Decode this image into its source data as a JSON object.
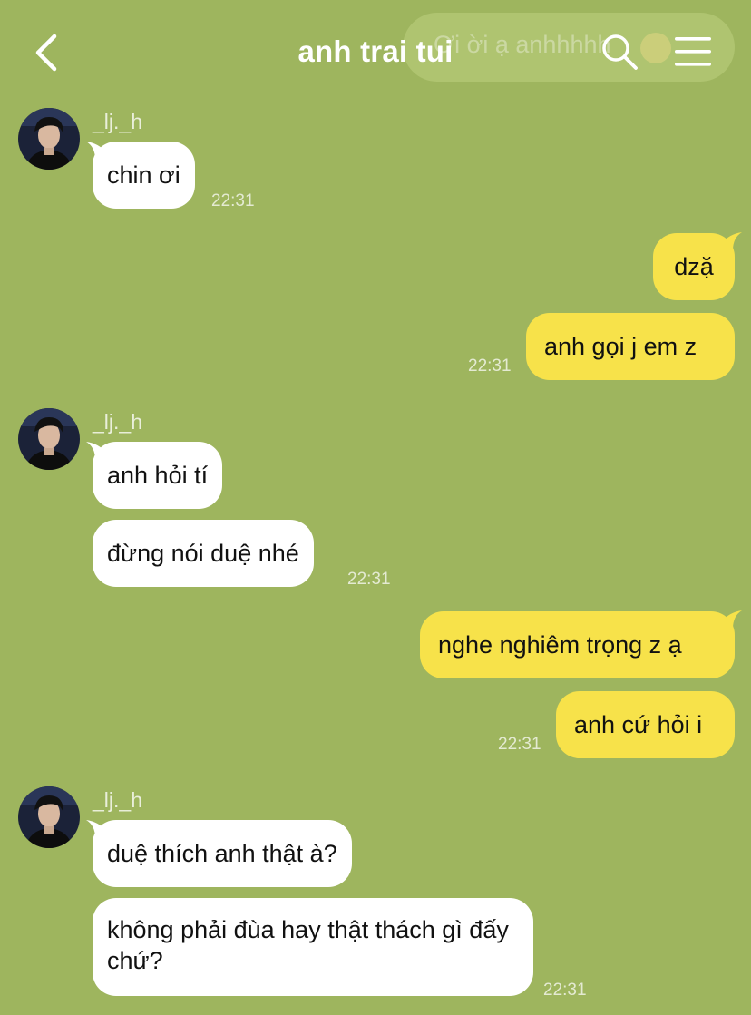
{
  "header": {
    "title": "anh trai tui",
    "back_icon": "chevron-left-icon",
    "search_icon": "search-icon",
    "menu_icon": "hamburger-menu-icon",
    "ghost_preview": "Ơi ời ạ anhhhhh"
  },
  "messages": [
    {
      "sender": "_lj._h",
      "side": "left",
      "text": "chin ơi",
      "time": "22:31"
    },
    {
      "side": "right",
      "text": "dzặ"
    },
    {
      "side": "right",
      "text": "anh gọi j em z",
      "time": "22:31"
    },
    {
      "sender": "_lj._h",
      "side": "left",
      "text": "anh hỏi tí"
    },
    {
      "side": "left",
      "text": "đừng nói duệ nhé",
      "time": "22:31"
    },
    {
      "side": "right",
      "text": "nghe nghiêm trọng z ạ"
    },
    {
      "side": "right",
      "text": "anh cứ hỏi i",
      "time": "22:31"
    },
    {
      "sender": "_lj._h",
      "side": "left",
      "text": "duệ thích anh thật à?"
    },
    {
      "side": "left",
      "text": "không phải đùa hay thật thách gì đấy chứ?",
      "time": "22:31"
    }
  ],
  "colors": {
    "background": "#9eb55e",
    "incoming_bubble": "#ffffff",
    "outgoing_bubble": "#f7e24a",
    "header_text": "#ffffff"
  }
}
